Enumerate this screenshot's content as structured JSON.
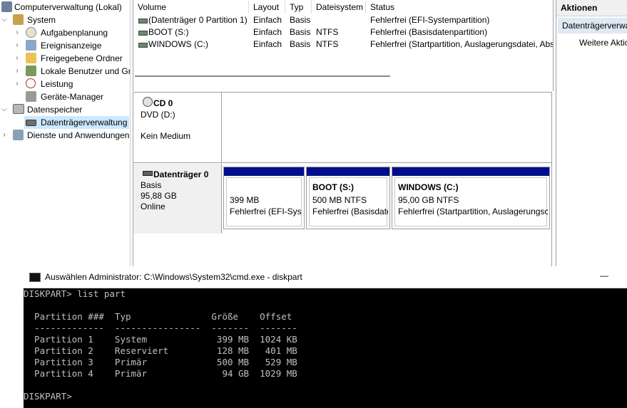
{
  "tree": {
    "root": "Computerverwaltung (Lokal)",
    "items": [
      {
        "label": "System"
      },
      {
        "label": "Aufgabenplanung"
      },
      {
        "label": "Ereignisanzeige"
      },
      {
        "label": "Freigegebene Ordner"
      },
      {
        "label": "Lokale Benutzer und Gr"
      },
      {
        "label": "Leistung"
      },
      {
        "label": "Geräte-Manager"
      },
      {
        "label": "Datenspeicher"
      },
      {
        "label": "Datenträgerverwaltung"
      },
      {
        "label": "Dienste und Anwendungen"
      }
    ]
  },
  "volumes": {
    "headers": [
      "Volume",
      "Layout",
      "Typ",
      "Dateisystem",
      "Status"
    ],
    "rows": [
      {
        "volume": "(Datenträger 0 Partition 1)",
        "layout": "Einfach",
        "typ": "Basis",
        "fs": "",
        "status": "Fehlerfrei (EFI-Systempartition)"
      },
      {
        "volume": "BOOT (S:)",
        "layout": "Einfach",
        "typ": "Basis",
        "fs": "NTFS",
        "status": "Fehlerfrei (Basisdatenpartition)"
      },
      {
        "volume": "WINDOWS (C:)",
        "layout": "Einfach",
        "typ": "Basis",
        "fs": "NTFS",
        "status": "Fehlerfrei (Startpartition, Auslagerungsdatei, Abs"
      }
    ]
  },
  "cd": {
    "name": "CD 0",
    "type": "DVD (D:)",
    "media": "Kein Medium"
  },
  "disk0": {
    "name": "Datenträger 0",
    "type": "Basis",
    "size": "95,88 GB",
    "state": "Online",
    "partitions": [
      {
        "name": "",
        "size": "399 MB",
        "status": "Fehlerfrei (EFI-Syste"
      },
      {
        "name": "BOOT  (S:)",
        "size": "500 MB NTFS",
        "status": "Fehlerfrei (Basisdate"
      },
      {
        "name": "WINDOWS  (C:)",
        "size": "95,00 GB NTFS",
        "status": "Fehlerfrei (Startpartition, Auslagerungsc"
      }
    ]
  },
  "actions": {
    "header": "Aktionen",
    "item1": "Datenträgerverwa",
    "item2": "Weitere Aktio"
  },
  "cmd": {
    "title": "Auswählen Administrator: C:\\Windows\\System32\\cmd.exe - diskpart",
    "minimize": "—",
    "lines": [
      "DISKPART> list part",
      "",
      "  Partition ###  Typ               Größe    Offset",
      "  -------------  ----------------  -------  -------",
      "  Partition 1    System             399 MB  1024 KB",
      "  Partition 2    Reserviert         128 MB   401 MB",
      "  Partition 3    Primär             500 MB   529 MB",
      "  Partition 4    Primär              94 GB  1029 MB",
      "",
      "DISKPART>"
    ]
  },
  "colors": {
    "partition_bar": "#000e8c",
    "selection": "#cce8ff"
  }
}
